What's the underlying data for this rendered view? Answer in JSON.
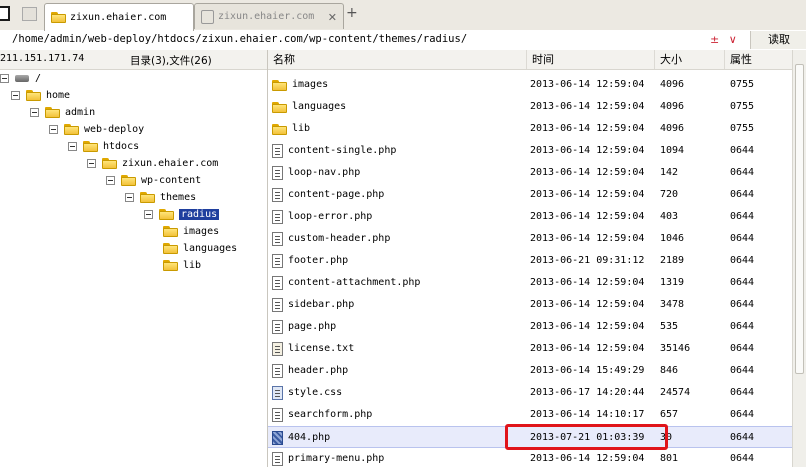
{
  "tabs": [
    {
      "label": "zixun.ehaier.com",
      "active": true
    },
    {
      "label": "zixun.ehaier.com",
      "active": false
    }
  ],
  "new_tab_label": "+",
  "path": "/home/admin/web-deploy/htdocs/zixun.ehaier.com/wp-content/themes/radius/",
  "path_controls": "± ∨",
  "read_button": "读取",
  "info": {
    "ip": "211.151.171.74",
    "summary": "目录(3),文件(26)"
  },
  "tree": [
    {
      "label": "/",
      "level": 0
    },
    {
      "label": "home",
      "level": 1
    },
    {
      "label": "admin",
      "level": 2
    },
    {
      "label": "web-deploy",
      "level": 3
    },
    {
      "label": "htdocs",
      "level": 4
    },
    {
      "label": "zixun.ehaier.com",
      "level": 5
    },
    {
      "label": "wp-content",
      "level": 6
    },
    {
      "label": "themes",
      "level": 7
    },
    {
      "label": "radius",
      "level": 8,
      "selected": true
    },
    {
      "label": "images",
      "level": 9
    },
    {
      "label": "languages",
      "level": 9
    },
    {
      "label": "lib",
      "level": 9
    }
  ],
  "columns": {
    "name": "名称",
    "time": "时间",
    "size": "大小",
    "attr": "属性"
  },
  "files": [
    {
      "icon": "folder",
      "name": "images",
      "time": "2013-06-14 12:59:04",
      "size": "4096",
      "attr": "0755"
    },
    {
      "icon": "folder",
      "name": "languages",
      "time": "2013-06-14 12:59:04",
      "size": "4096",
      "attr": "0755"
    },
    {
      "icon": "folder",
      "name": "lib",
      "time": "2013-06-14 12:59:04",
      "size": "4096",
      "attr": "0755"
    },
    {
      "icon": "file",
      "name": "content-single.php",
      "time": "2013-06-14 12:59:04",
      "size": "1094",
      "attr": "0644"
    },
    {
      "icon": "file",
      "name": "loop-nav.php",
      "time": "2013-06-14 12:59:04",
      "size": "142",
      "attr": "0644"
    },
    {
      "icon": "file",
      "name": "content-page.php",
      "time": "2013-06-14 12:59:04",
      "size": "720",
      "attr": "0644"
    },
    {
      "icon": "file",
      "name": "loop-error.php",
      "time": "2013-06-14 12:59:04",
      "size": "403",
      "attr": "0644"
    },
    {
      "icon": "file",
      "name": "custom-header.php",
      "time": "2013-06-14 12:59:04",
      "size": "1046",
      "attr": "0644"
    },
    {
      "icon": "file",
      "name": "footer.php",
      "time": "2013-06-21 09:31:12",
      "size": "2189",
      "attr": "0644"
    },
    {
      "icon": "file",
      "name": "content-attachment.php",
      "time": "2013-06-14 12:59:04",
      "size": "1319",
      "attr": "0644"
    },
    {
      "icon": "file",
      "name": "sidebar.php",
      "time": "2013-06-14 12:59:04",
      "size": "3478",
      "attr": "0644"
    },
    {
      "icon": "file",
      "name": "page.php",
      "time": "2013-06-14 12:59:04",
      "size": "535",
      "attr": "0644"
    },
    {
      "icon": "txt",
      "name": "license.txt",
      "time": "2013-06-14 12:59:04",
      "size": "35146",
      "attr": "0644"
    },
    {
      "icon": "file",
      "name": "header.php",
      "time": "2013-06-14 15:49:29",
      "size": "846",
      "attr": "0644"
    },
    {
      "icon": "css",
      "name": "style.css",
      "time": "2013-06-17 14:20:44",
      "size": "24574",
      "attr": "0644"
    },
    {
      "icon": "file",
      "name": "searchform.php",
      "time": "2013-06-14 14:10:17",
      "size": "657",
      "attr": "0644"
    },
    {
      "icon": "img",
      "name": "404.php",
      "time": "2013-07-21 01:03:39",
      "size": "30",
      "attr": "0644",
      "highlighted": true
    },
    {
      "icon": "file",
      "name": "primary-menu.php",
      "time": "2013-06-14 12:59:04",
      "size": "801",
      "attr": "0644"
    }
  ],
  "colors": {
    "selection": "#1f3f9e",
    "highlight_box": "#e0141a",
    "highlight_row": "#e8ebfb"
  }
}
